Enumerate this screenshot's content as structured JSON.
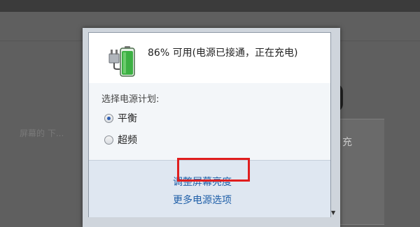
{
  "background": {
    "side_text": "屏幕的 下...",
    "panel_text": "充"
  },
  "power_popup": {
    "battery_status": "86% 可用(电源已接通，正在充电)",
    "plan_section_label": "选择电源计划:",
    "plans": [
      {
        "label": "平衡",
        "selected": true
      },
      {
        "label": "超频",
        "selected": false
      }
    ],
    "links": {
      "adjust_brightness": "调整屏幕亮度",
      "more_power_options": "更多电源选项"
    }
  },
  "colors": {
    "link": "#1f5fa8",
    "highlight_box": "#e01e1e",
    "battery_fill": "#3cb043"
  },
  "icons": {
    "battery": "battery-charging-icon",
    "scroll": "scroll-down-arrow-icon"
  }
}
